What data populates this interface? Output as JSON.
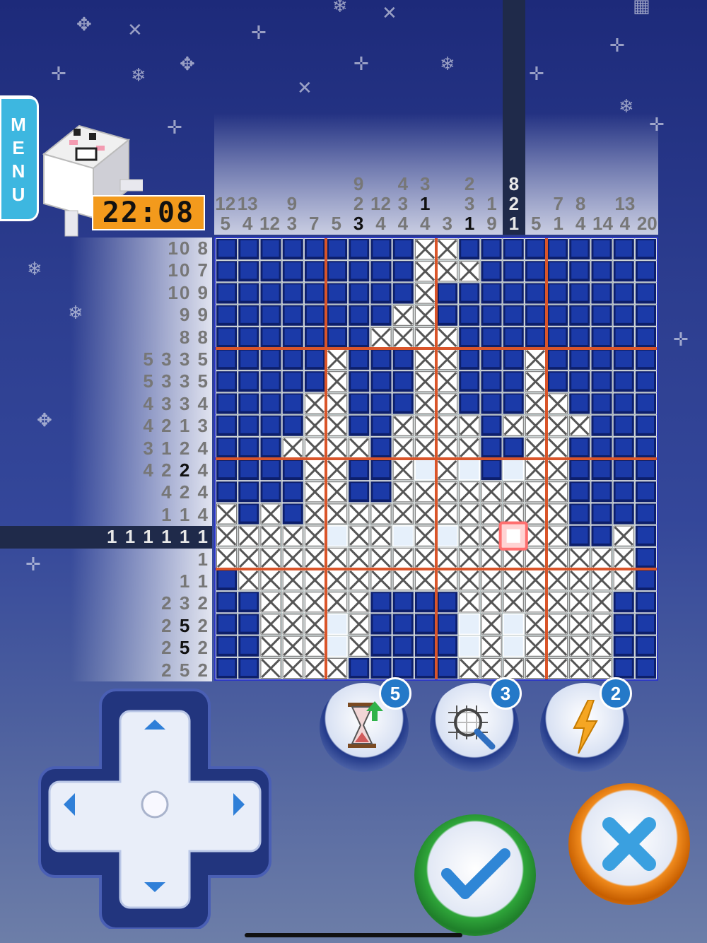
{
  "menu": {
    "label": "MENU"
  },
  "timer": {
    "value": "22:08"
  },
  "column_clues": [
    [
      [
        "12"
      ],
      [
        "5"
      ]
    ],
    [
      [
        "13"
      ],
      [
        "4"
      ]
    ],
    [
      [
        "12"
      ]
    ],
    [
      [
        "9"
      ],
      [
        "3"
      ]
    ],
    [
      [
        "7"
      ]
    ],
    [
      [
        "5"
      ]
    ],
    [
      [
        "9"
      ],
      [
        "2"
      ],
      [
        "3",
        "b"
      ]
    ],
    [
      [
        "12"
      ],
      [
        "4"
      ]
    ],
    [
      [
        "4"
      ],
      [
        "3"
      ],
      [
        "4"
      ]
    ],
    [
      [
        "3"
      ],
      [
        "1",
        "b"
      ],
      [
        "4"
      ]
    ],
    [
      [
        "3"
      ]
    ],
    [
      [
        "2"
      ],
      [
        "3"
      ],
      [
        "1",
        "b"
      ]
    ],
    [
      [
        "1"
      ],
      [
        "9"
      ]
    ],
    [
      [
        "8"
      ],
      [
        "2",
        "w"
      ],
      [
        "1",
        "w"
      ]
    ],
    [
      [
        "5"
      ]
    ],
    [
      [
        "7"
      ],
      [
        "1"
      ]
    ],
    [
      [
        "8"
      ],
      [
        "4"
      ]
    ],
    [
      [
        "14"
      ]
    ],
    [
      [
        "13"
      ],
      [
        "4"
      ]
    ],
    [
      [
        "20"
      ]
    ]
  ],
  "row_clues": [
    [
      [
        "10"
      ],
      [
        "8"
      ]
    ],
    [
      [
        "10"
      ],
      [
        "7"
      ]
    ],
    [
      [
        "10"
      ],
      [
        "9"
      ]
    ],
    [
      [
        "9"
      ],
      [
        "9"
      ]
    ],
    [
      [
        "8"
      ],
      [
        "8"
      ]
    ],
    [
      [
        "5"
      ],
      [
        "3"
      ],
      [
        "3"
      ],
      [
        "5"
      ]
    ],
    [
      [
        "5"
      ],
      [
        "3"
      ],
      [
        "3"
      ],
      [
        "5"
      ]
    ],
    [
      [
        "4"
      ],
      [
        "3"
      ],
      [
        "3"
      ],
      [
        "4"
      ]
    ],
    [
      [
        "4"
      ],
      [
        "2"
      ],
      [
        "1"
      ],
      [
        "3"
      ]
    ],
    [
      [
        "3"
      ],
      [
        "1"
      ],
      [
        "2"
      ],
      [
        "4"
      ]
    ],
    [
      [
        "4"
      ],
      [
        "2"
      ],
      [
        "2",
        "b"
      ],
      [
        "4"
      ]
    ],
    [
      [
        "4"
      ],
      [
        "2"
      ],
      [
        "4"
      ]
    ],
    [
      [
        "1"
      ],
      [
        "1"
      ],
      [
        "4"
      ]
    ],
    [
      [
        "1"
      ],
      [
        "1"
      ],
      [
        "1"
      ],
      [
        "1"
      ],
      [
        "1"
      ],
      [
        "1"
      ]
    ],
    [
      [
        "1"
      ]
    ],
    [
      [
        "1"
      ],
      [
        "1"
      ]
    ],
    [
      [
        "2"
      ],
      [
        "3"
      ],
      [
        "2"
      ]
    ],
    [
      [
        "2"
      ],
      [
        "5",
        "b"
      ],
      [
        "2"
      ]
    ],
    [
      [
        "2"
      ],
      [
        "5",
        "b"
      ],
      [
        "2"
      ]
    ],
    [
      [
        "2"
      ],
      [
        "5"
      ],
      [
        "2"
      ]
    ]
  ],
  "active_row": 13,
  "active_column": 13,
  "board_rows": [
    "FFFFFFFFFXXFFFFFFFFF",
    "FFFFFFFFFXXXFFFFFFFF",
    "FFFFFFFFFXFFFFFFFFFF",
    "FFFFFFFFXXFFFFFFFFFF",
    "FFFFFFFXXXXFFFFFFFFF",
    "FFFFFXFFFXXFFFXFFFFF",
    "FFFFFXFFFXXFFFXFFFFF",
    "FFFFXXFFFXXFFFXXFFFF",
    "FFFFXXFFXXXXFXXXXFFF",
    "FFFXXXXFXXXXFFXXFFFF",
    "FFFFXXFFXOXOFOXXFFFF",
    "FFFFXXFFXXXXXXXXFFFF",
    "XFXFXXXXXXXXXXXXFFFF",
    "XXXXXOXXOXOXXSXXFFXF",
    "XXXXXXXXXXXXXXXXXXXF",
    "FXXXXXXXXXXXXXXXXXXF",
    "FFXXXXXFFFFXXXXXXXFF",
    "FFXXXOXFFFFOXOXXXXFF",
    "FFXXXOXFFFFOXOXXXXFF",
    "FFXXXXFFFFFXXXXXXXFF"
  ],
  "tools": [
    {
      "name": "hourglass-icon",
      "count": "5"
    },
    {
      "name": "magnifier-grid-icon",
      "count": "3"
    },
    {
      "name": "lightning-icon",
      "count": "2"
    }
  ],
  "colors": {
    "filled": "#1b3aa8",
    "filled_edge": "#0d1f6b",
    "cross": "#555",
    "separator": "#d9552a",
    "frame": "#2a35c8",
    "highlight": "#ff6f6f"
  }
}
